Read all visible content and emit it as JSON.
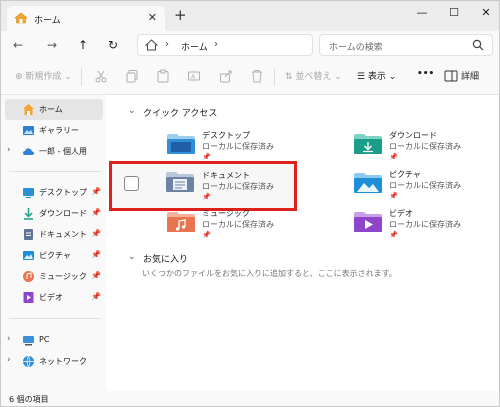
{
  "tab": {
    "title": "ホーム",
    "close": "✕",
    "new_tab": "+"
  },
  "window_controls": {
    "minimize": "—",
    "maximize": "☐",
    "close": "✕"
  },
  "nav": {
    "back": "←",
    "forward": "→",
    "up": "↑",
    "refresh": "↻"
  },
  "address": {
    "sep1": "›",
    "path": "ホーム",
    "sep2": "›"
  },
  "search": {
    "placeholder": "ホームの検索"
  },
  "toolbar": {
    "new_label": "⊕ 新規作成 ⌄",
    "sort_label": "⇅ 並べ替え ⌄",
    "view_label": "☰ 表示 ⌄",
    "more_label": "•••",
    "details_label": "詳細"
  },
  "sidebar": {
    "items": [
      {
        "label": "ホーム",
        "icon": "home-icon"
      },
      {
        "label": "ギャラリー",
        "icon": "gallery-icon"
      },
      {
        "label": "一郎 - 個人用",
        "icon": "cloud-icon",
        "chevron": "›"
      }
    ],
    "pinned": [
      {
        "label": "デスクトップ",
        "icon": "desktop-icon",
        "pin": "📌"
      },
      {
        "label": "ダウンロード",
        "icon": "download-icon",
        "pin": "📌"
      },
      {
        "label": "ドキュメント",
        "icon": "document-icon",
        "pin": "📌"
      },
      {
        "label": "ピクチャ",
        "icon": "picture-icon",
        "pin": "📌"
      },
      {
        "label": "ミュージック",
        "icon": "music-icon",
        "pin": "📌"
      },
      {
        "label": "ビデオ",
        "icon": "video-icon",
        "pin": "📌"
      }
    ],
    "bottom": [
      {
        "label": "PC",
        "icon": "pc-icon",
        "chevron": "›"
      },
      {
        "label": "ネットワーク",
        "icon": "network-icon",
        "chevron": "›"
      }
    ]
  },
  "quick_access": {
    "title": "クイック アクセス",
    "chevron": "⌄",
    "items": [
      {
        "name": "デスクトップ",
        "sub": "ローカルに保存済み",
        "pin": "📌",
        "color": "#2f8fd6"
      },
      {
        "name": "ダウンロード",
        "sub": "ローカルに保存済み",
        "pin": "📌",
        "color": "#1a9e8a"
      },
      {
        "name": "ドキュメント",
        "sub": "ローカルに保存済み",
        "pin": "📌",
        "color": "#6b84a6"
      },
      {
        "name": "ピクチャ",
        "sub": "ローカルに保存済み",
        "pin": "📌",
        "color": "#1e8ed9"
      },
      {
        "name": "ミュージック",
        "sub": "ローカルに保存済み",
        "pin": "📌",
        "color": "#e8754f"
      },
      {
        "name": "ビデオ",
        "sub": "ローカルに保存済み",
        "pin": "📌",
        "color": "#8e45c9"
      }
    ]
  },
  "favorites": {
    "title": "お気に入り",
    "chevron": "⌄",
    "description": "いくつかのファイルをお気に入りに追加すると、ここに表示されます。"
  },
  "status": {
    "text": "6 個の項目"
  },
  "colors": {
    "highlight": "#e0201b",
    "selected_bg": "#e5e5e5"
  }
}
